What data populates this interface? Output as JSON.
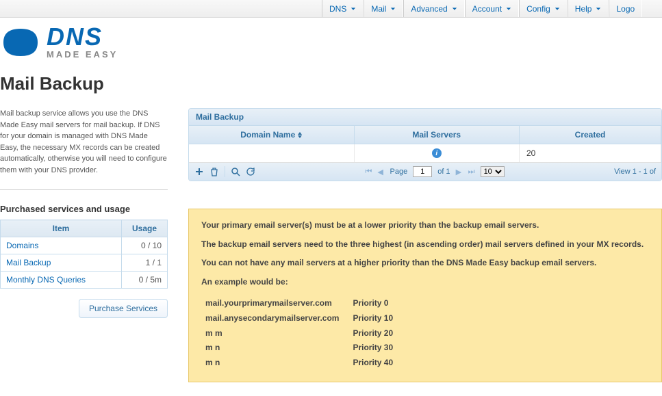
{
  "nav": [
    "DNS",
    "Mail",
    "Advanced",
    "Account",
    "Config",
    "Help",
    "Logo"
  ],
  "logo": {
    "dns": "DNS",
    "made": "MADE EASY"
  },
  "page": {
    "title": "Mail Backup",
    "desc": "Mail backup service allows you use the DNS Made Easy mail servers for mail backup. If DNS for your domain is managed with DNS Made Easy, the necessary MX records can be created automatically, otherwise you will need to configure them with your DNS provider."
  },
  "usage": {
    "heading": "Purchased services and usage",
    "cols": [
      "Item",
      "Usage"
    ],
    "rows": [
      {
        "item": "Domains",
        "usage": "0 / 10"
      },
      {
        "item": "Mail Backup",
        "usage": "1 / 1"
      },
      {
        "item": "Monthly DNS Queries",
        "usage": "0 / 5m"
      }
    ],
    "purchase_btn": "Purchase Services"
  },
  "grid": {
    "title": "Mail Backup",
    "cols": [
      "Domain Name",
      "Mail Servers",
      "Created"
    ],
    "row": {
      "domain": "",
      "servers_info": "i",
      "created": "20"
    },
    "pager": {
      "page_label": "Page",
      "page": "1",
      "of_label": "of 1",
      "per_page": "10",
      "view": "View 1 - 1 of "
    }
  },
  "notice": {
    "l1": "Your primary email server(s) must be at a lower priority than the backup email servers.",
    "l2": "The backup email servers need to the three highest (in ascending order) mail servers defined in your MX records.",
    "l3": "You can not have any mail servers at a higher priority than the DNS Made Easy backup email servers.",
    "l4": "An example would be:",
    "examples": [
      {
        "host": "mail.yourprimarymailserver.com",
        "prio": "Priority 0"
      },
      {
        "host": "mail.anysecondarymailserver.com",
        "prio": "Priority 10"
      },
      {
        "host": "m                              m",
        "prio": "Priority 20"
      },
      {
        "host": "m                              n",
        "prio": "Priority 30"
      },
      {
        "host": "m                              n",
        "prio": "Priority 40"
      }
    ]
  }
}
